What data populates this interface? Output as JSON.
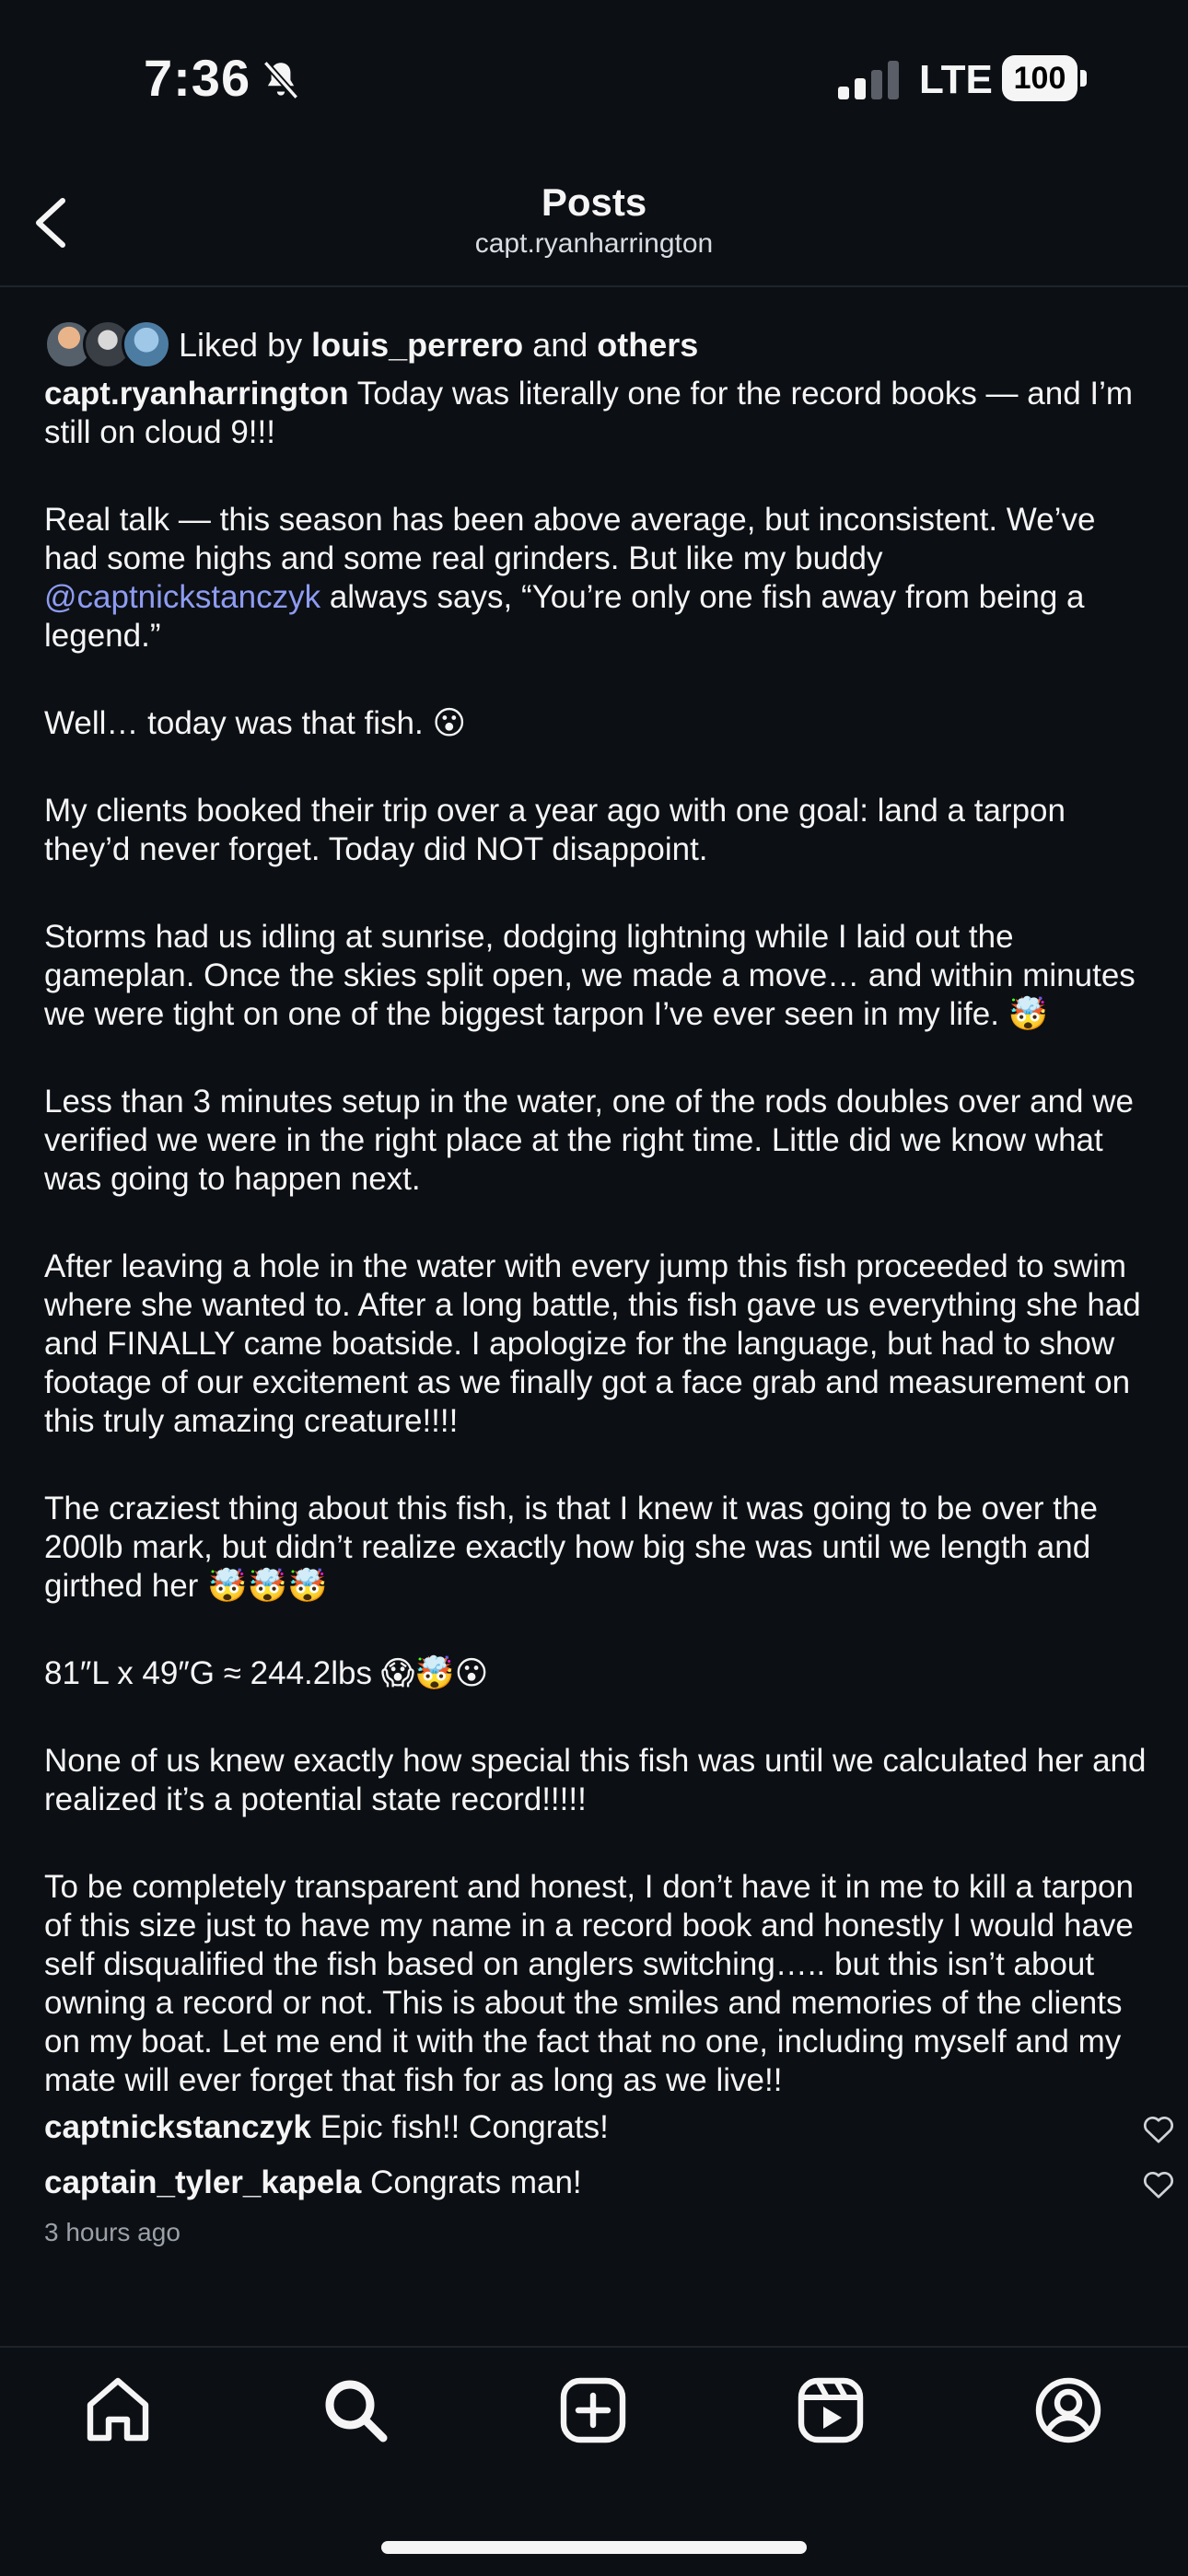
{
  "status": {
    "time": "7:36",
    "network": "LTE",
    "battery": "100"
  },
  "nav": {
    "title": "Posts",
    "subtitle": "capt.ryanharrington"
  },
  "liked": {
    "prefix": "Liked by ",
    "user": "louis_perrero",
    "mid": " and ",
    "others": "others"
  },
  "post": {
    "author": "capt.ryanharrington",
    "first_line": " Today was literally one for the record books — and I’m still on cloud 9!!!",
    "p1_a": "Real talk — this season has been above average, but inconsistent. We’ve had some highs and some real grinders. But like my buddy ",
    "p1_mention": "@captnickstanczyk",
    "p1_b": " always says, “You’re only one fish away from being a legend.”",
    "p2": "Well… today was that fish. 😮",
    "p3": "My clients booked their trip over a year ago with one goal: land a tarpon they’d never forget. Today did NOT disappoint.",
    "p4": "Storms had us idling at sunrise, dodging lightning while I laid out the gameplan. Once the skies split open, we made a move… and within minutes we were tight on one of the biggest tarpon I’ve ever seen in my life. 🤯",
    "p5": "Less than 3 minutes setup in the water, one of the rods doubles over and we verified we were in the right place at the right time. Little did we know what was going to happen next.",
    "p6": "After leaving a hole in the water with every jump this fish proceeded to swim where she wanted to. After a long battle, this fish gave us everything she had and FINALLY came boatside. I apologize for the language, but had to show footage of our excitement as we finally got a face grab and measurement on this truly amazing creature!!!!",
    "p7": "The craziest thing about this fish, is that I knew it was going to be over the 200lb mark, but didn’t realize exactly how big she was until we length and girthed her 🤯🤯🤯",
    "p8": "81″L x 49″G ≈ 244.2lbs 😱🤯😮",
    "p9": "None of us knew exactly how special this fish was until we calculated her and realized it’s a potential state record!!!!!",
    "p10": "To be completely transparent and honest, I don’t have it in me to kill a tarpon of this size just to have my name in a record book and honestly I would have self disqualified the fish based on anglers switching….. but this isn’t about owning a record or not. This is about the smiles and memories of the clients on my boat. Let me end it with the fact that no one, including myself and my mate will ever forget that fish for as long as we live!!"
  },
  "comments": [
    {
      "user": "captnickstanczyk",
      "text": " Epic fish!! Congrats!"
    },
    {
      "user": "captain_tyler_kapela",
      "text": " Congrats man!"
    }
  ],
  "time_ago": "3 hours ago",
  "tabs": [
    "home-icon",
    "search-icon",
    "create-icon",
    "reels-icon",
    "profile-icon"
  ]
}
